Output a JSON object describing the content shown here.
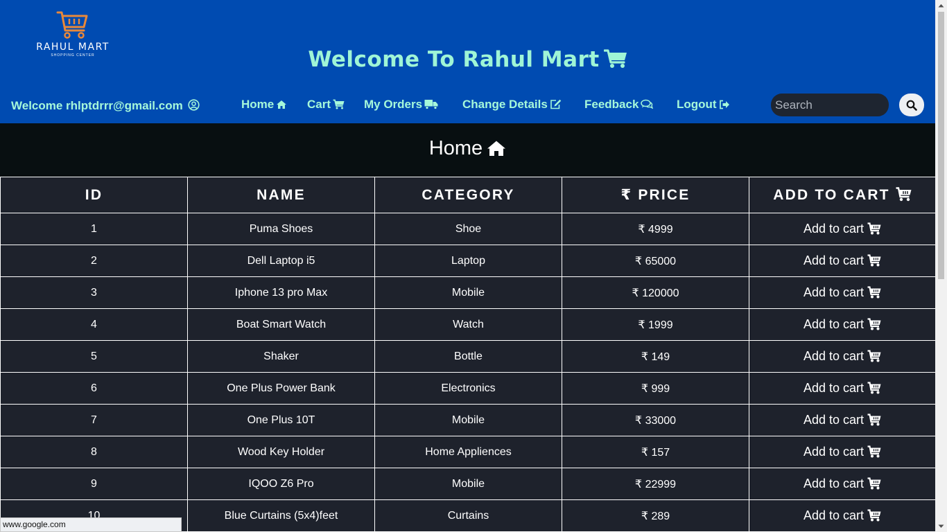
{
  "logo": {
    "brand": "RAHUL MART",
    "tagline": "SHOPPING CENTER"
  },
  "header": {
    "title": "Welcome To Rahul Mart"
  },
  "nav": {
    "user_welcome": "Welcome rhlptdrrr@gmail.com",
    "items": [
      {
        "label": "Home",
        "icon": "home-icon"
      },
      {
        "label": "Cart",
        "icon": "cart-icon"
      },
      {
        "label": "My Orders",
        "icon": "truck-icon"
      },
      {
        "label": "Change Details",
        "icon": "edit-icon"
      },
      {
        "label": "Feedback",
        "icon": "comments-icon"
      },
      {
        "label": "Logout",
        "icon": "sign-out-icon"
      }
    ],
    "search_placeholder": "Search"
  },
  "banner": {
    "title": "Home"
  },
  "table": {
    "headers": {
      "id": "ID",
      "name": "NAME",
      "category": "CATEGORY",
      "price": "PRICE",
      "add_to_cart": "ADD TO CART"
    },
    "currency_symbol": "₹",
    "add_label": "Add to cart",
    "rows": [
      {
        "id": "1",
        "name": "Puma Shoes",
        "category": "Shoe",
        "price": "4999"
      },
      {
        "id": "2",
        "name": "Dell Laptop i5",
        "category": "Laptop",
        "price": "65000"
      },
      {
        "id": "3",
        "name": "Iphone 13 pro Max",
        "category": "Mobile",
        "price": "120000"
      },
      {
        "id": "4",
        "name": "Boat Smart Watch",
        "category": "Watch",
        "price": "1999"
      },
      {
        "id": "5",
        "name": "Shaker",
        "category": "Bottle",
        "price": "149"
      },
      {
        "id": "6",
        "name": "One Plus Power Bank",
        "category": "Electronics",
        "price": "999"
      },
      {
        "id": "7",
        "name": "One Plus 10T",
        "category": "Mobile",
        "price": "33000"
      },
      {
        "id": "8",
        "name": "Wood Key Holder",
        "category": "Home Appliences",
        "price": "157"
      },
      {
        "id": "9",
        "name": "IQOO Z6 Pro",
        "category": "Mobile",
        "price": "22999"
      },
      {
        "id": "10",
        "name": "Blue Curtains (5x4)feet",
        "category": "Curtains",
        "price": "289"
      }
    ]
  },
  "status_bar": {
    "url": "www.google.com"
  },
  "colors": {
    "header_bg": "#004bb1",
    "accent_text": "#9ff5d6",
    "banner_bg": "#080f11",
    "table_bg": "#1e222c",
    "logo_orange": "#e8883a"
  }
}
